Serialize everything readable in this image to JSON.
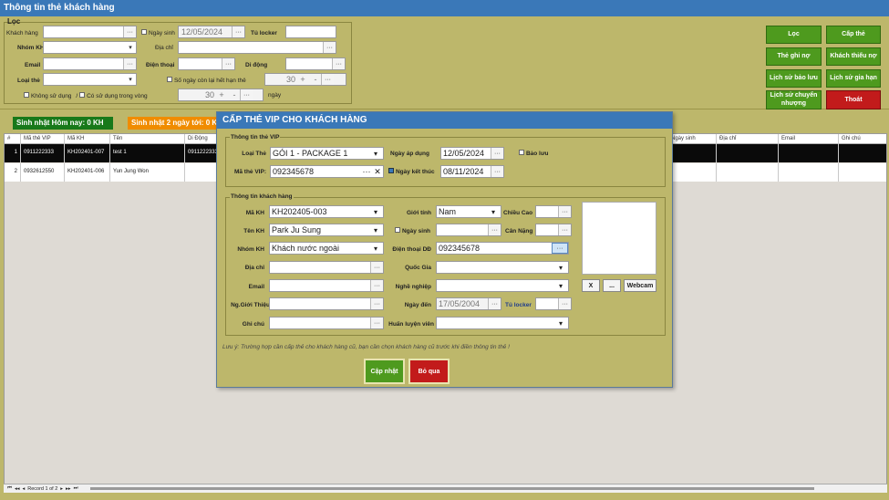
{
  "window": {
    "title": "Thông tin thẻ khách hàng"
  },
  "filter": {
    "legend": "Lọc",
    "customer_label": "Khách hàng",
    "group_label": "Nhóm KH",
    "email_label": "Email",
    "card_type_label": "Loại thẻ",
    "birthday_label": "Ngày sinh",
    "birthday_value": "12/05/2024",
    "locker_label": "Tủ locker",
    "address_label": "Địa chỉ",
    "phone_label": "Điện thoại",
    "mobile_label": "Di động",
    "days_left_label": "Số ngày còn lại hết hạn thẻ",
    "days_left_value": "30",
    "not_used_label": "Không sử dụng",
    "slash": "/",
    "used_within_label": "Có sử dụng trong vòng",
    "used_within_value": "30",
    "days_unit": "ngày",
    "plus": "+",
    "minus": "-",
    "ellipsis": "···"
  },
  "actions": {
    "filter": "Lọc",
    "issue_card": "Cấp thẻ",
    "debt_card": "Thẻ ghi nợ",
    "debt_customers": "Khách thiếu nợ",
    "reserve_history": "Lịch sử bảo lưu",
    "extend_history": "Lịch sử gia hạn",
    "transfer_history": "Lịch sử chuyển nhượng",
    "exit": "Thoát"
  },
  "badges": {
    "birthday_today": "Sinh nhật Hôm nay: 0 KH",
    "birthday_2days": "Sinh nhật 2 ngày tới: 0 KH"
  },
  "grid": {
    "headers": [
      "#",
      "Mã thẻ VIP",
      "Mã KH",
      "Tên",
      "Di Động",
      "Ngày sinh",
      "Địa chỉ",
      "Email",
      "Ghi chú"
    ],
    "rows": [
      {
        "num": "1",
        "vip": "0911222333",
        "kh": "KH202401-007",
        "name": "test 1",
        "mobile": "0911222333"
      },
      {
        "num": "2",
        "vip": "0932612550",
        "kh": "KH202401-006",
        "name": "Yun Jung Won",
        "mobile": ""
      }
    ],
    "record": "Record 1 of 2"
  },
  "dialog": {
    "title": "CẤP THẺ VIP CHO KHÁCH HÀNG",
    "card_section": "Thông tin thẻ VIP",
    "card_type_label": "Loại Thẻ",
    "card_type_value": "GÓI 1 - PACKAGE 1",
    "apply_date_label": "Ngày áp dụng",
    "apply_date_value": "12/05/2024",
    "reserve_label": "Bảo lưu",
    "vip_code_label": "Mã thẻ VIP:",
    "vip_code_value": "092345678",
    "end_date_label": "Ngày kết thúc",
    "end_date_value": "08/11/2024",
    "cust_section": "Thông tin khách hàng",
    "kh_code_label": "Mã KH",
    "kh_code_value": "KH202405-003",
    "gender_label": "Giới tính",
    "gender_value": "Nam",
    "height_label": "Chiều Cao",
    "name_label": "Tên KH",
    "name_value": "Park Ju Sung",
    "dob_label": "Ngày sinh",
    "weight_label": "Cân Nặng",
    "group_label": "Nhóm KH",
    "group_value": "Khách nước ngoài",
    "phone_label": "Điện thoại DĐ",
    "phone_value": "092345678",
    "address_label": "Địa chỉ",
    "country_label": "Quốc Gia",
    "email_label": "Email",
    "job_label": "Nghề nghiệp",
    "referrer_label": "Ng.Giới Thiệu",
    "arrive_label": "Ngày đến",
    "arrive_value": "17/05/2004",
    "locker_label": "Tủ locker",
    "note_label": "Ghi chú",
    "coach_label": "Huấn luyện viên",
    "photo_x": "X",
    "photo_browse": "...",
    "photo_webcam": "Webcam",
    "hint": "Lưu ý: Trường hợp cần cấp thẻ cho khách hàng cũ, bạn cần chọn khách hàng cũ trước khi điền thông tin thẻ !",
    "save": "Cập nhật",
    "cancel": "Bỏ qua"
  },
  "colors": {
    "titlebar": "#3a78b8",
    "panel": "#bdb76b",
    "green": "#4e9a1e",
    "red": "#c21b1b",
    "orange": "#f08c00"
  }
}
